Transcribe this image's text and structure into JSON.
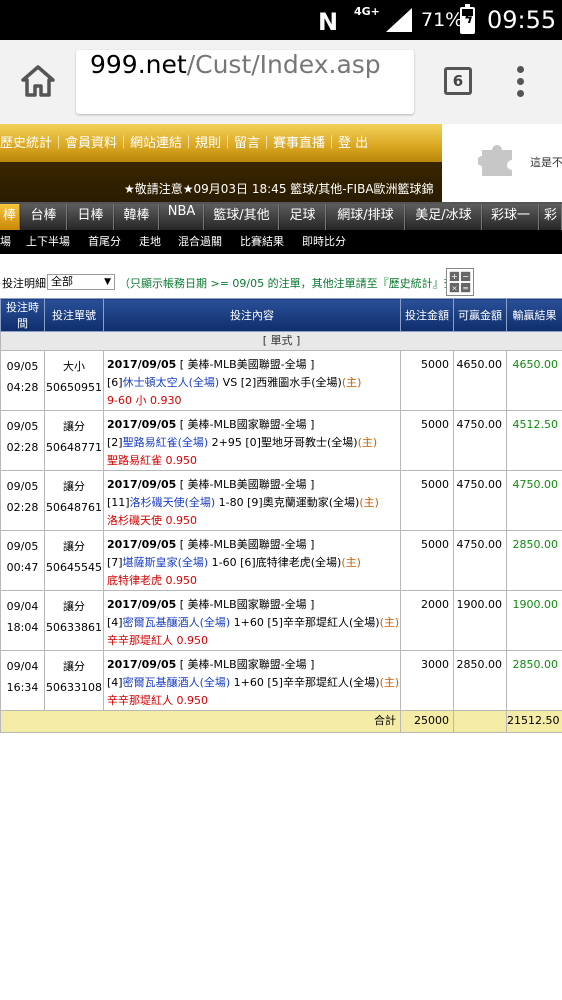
{
  "status_bar": {
    "network": "4G+",
    "battery_percent": "71%",
    "battery_level": 0.71,
    "time": "09:55"
  },
  "browser": {
    "url_host": "999.net",
    "url_path": "/Cust/Index.asp",
    "tab_count": "6"
  },
  "site": {
    "top_links": "歷史統計｜會員資料｜網站連結｜規則｜留言｜賽事直播｜登 出",
    "notice": "★敬請注意★09月03日 18:45 籃球/其他-FIBA歐洲籃球錦",
    "ad_text": "這是不"
  },
  "sports_tabs": [
    "棒",
    "台棒",
    "日棒",
    "韓棒",
    "NBA",
    "籃球/其他",
    "足球",
    "網球/排球",
    "美足/冰球",
    "彩球一",
    "彩"
  ],
  "sub_tabs": [
    "場",
    "上下半場",
    "首尾分",
    "走地",
    "混合過關",
    "比賽結果",
    "即時比分"
  ],
  "filter": {
    "label": "投注明細:",
    "selected": "全部",
    "hint": "（只顯示帳務日期 >= 09/05 的注單，其他注單請至『歷史統計』查詢）"
  },
  "table": {
    "headers": [
      "投注時間",
      "投注單號",
      "投注內容",
      "投注金額",
      "可贏金額",
      "輸贏結果"
    ],
    "section_label": "[ 單式 ]",
    "rows": [
      {
        "date": "09/05",
        "time": "04:28",
        "type": "大小",
        "bet_no": "50650951",
        "match_date": "2017/09/05",
        "league": "[ 美棒-MLB美國聯盟-全場 ]",
        "line2": {
          "idx1": "[6]",
          "team1": "休士頓太空人(全場)",
          "mid": " VS [2]西雅圖水手(全場)",
          "arrow": "(主)"
        },
        "pick": "9-60 小 0.930",
        "amount": "5000",
        "win_amount": "4650.00",
        "result": "4650.00"
      },
      {
        "date": "09/05",
        "time": "02:28",
        "type": "讓分",
        "bet_no": "50648771",
        "match_date": "2017/09/05",
        "league": "[ 美棒-MLB國家聯盟-全場 ]",
        "line2": {
          "idx1": "[2]",
          "team1": "聖路易紅雀(全場)",
          "mid": " 2+95 [0]聖地牙哥教士(全場)",
          "arrow": "(主)"
        },
        "pick": "聖路易紅雀 0.950",
        "amount": "5000",
        "win_amount": "4750.00",
        "result": "4512.50"
      },
      {
        "date": "09/05",
        "time": "02:28",
        "type": "讓分",
        "bet_no": "50648761",
        "match_date": "2017/09/05",
        "league": "[ 美棒-MLB美國聯盟-全場 ]",
        "line2": {
          "idx1": "[11]",
          "team1": "洛杉磯天使(全場)",
          "mid": " 1-80 [9]奧克蘭運動家(全場)",
          "arrow": "(主)"
        },
        "pick": "洛杉磯天使 0.950",
        "amount": "5000",
        "win_amount": "4750.00",
        "result": "4750.00"
      },
      {
        "date": "09/05",
        "time": "00:47",
        "type": "讓分",
        "bet_no": "50645545",
        "match_date": "2017/09/05",
        "league": "[ 美棒-MLB美國聯盟-全場 ]",
        "line2": {
          "idx1": "[7]",
          "team1": "堪薩斯皇家(全場)",
          "mid": " 1-60 [6]底特律老虎(全場)",
          "arrow": "(主)"
        },
        "pick": "底特律老虎 0.950",
        "amount": "5000",
        "win_amount": "4750.00",
        "result": "2850.00"
      },
      {
        "date": "09/04",
        "time": "18:04",
        "type": "讓分",
        "bet_no": "50633861",
        "match_date": "2017/09/05",
        "league": "[ 美棒-MLB國家聯盟-全場 ]",
        "line2": {
          "idx1": "[4]",
          "team1": "密爾瓦基釀酒人(全場)",
          "mid": " 1+60 [5]辛辛那堤紅人(全場)",
          "arrow": "(主)"
        },
        "pick": "辛辛那堤紅人 0.950",
        "amount": "2000",
        "win_amount": "1900.00",
        "result": "1900.00"
      },
      {
        "date": "09/04",
        "time": "16:34",
        "type": "讓分",
        "bet_no": "50633108",
        "match_date": "2017/09/05",
        "league": "[ 美棒-MLB國家聯盟-全場 ]",
        "line2": {
          "idx1": "[4]",
          "team1": "密爾瓦基釀酒人(全場)",
          "mid": " 1+60 [5]辛辛那堤紅人(全場)",
          "arrow": "(主)"
        },
        "pick": "辛辛那堤紅人 0.950",
        "amount": "3000",
        "win_amount": "2850.00",
        "result": "2850.00"
      }
    ],
    "total": {
      "label": "合計",
      "amount": "25000",
      "result": "21512.50"
    }
  }
}
